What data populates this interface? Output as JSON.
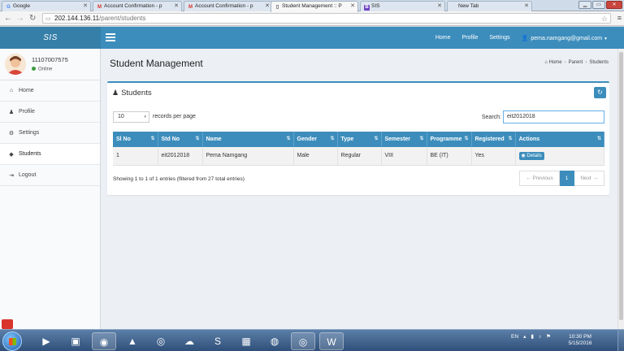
{
  "browser": {
    "tabs": [
      {
        "label": "Google",
        "icon": "G",
        "icon_color": "#4285f4"
      },
      {
        "label": "Account Confirmation - p",
        "icon": "M",
        "icon_color": "#d93025"
      },
      {
        "label": "Account Confirmation - p",
        "icon": "M",
        "icon_color": "#d93025"
      },
      {
        "label": "Student Management :: P",
        "icon": "▯",
        "icon_color": "#555555"
      },
      {
        "label": "SIS",
        "icon": "B",
        "icon_color": "#6f42c1"
      },
      {
        "label": "New Tab",
        "icon": "",
        "icon_color": "#777777"
      }
    ],
    "url_host": "202.144.136.11",
    "url_path": "/parent/students"
  },
  "app": {
    "logo": "SIS",
    "nav": {
      "home": "Home",
      "profile": "Profile",
      "settings": "Settings",
      "user_email": "pema.namgang@gmail.com"
    },
    "user": {
      "id": "11107007575",
      "status": "Online"
    },
    "sidebar": [
      {
        "label": "Home",
        "icon": "home-icon",
        "glyph": "⌂"
      },
      {
        "label": "Profile",
        "icon": "user-icon",
        "glyph": "●"
      },
      {
        "label": "Settings",
        "icon": "gear-icon",
        "glyph": "⚙"
      },
      {
        "label": "Students",
        "icon": "graduation-cap-icon",
        "glyph": "🎓"
      },
      {
        "label": "Logout",
        "icon": "sign-out-icon",
        "glyph": "⇥"
      }
    ],
    "page_title": "Student Management",
    "breadcrumb": [
      "Home",
      "Parent",
      "Students"
    ],
    "box_title": "Students",
    "length_value": "10",
    "length_label": "records per page",
    "search_label": "Search:",
    "search_value": "eit2012018",
    "table": {
      "columns": [
        "Sl No",
        "Std No",
        "Name",
        "Gender",
        "Type",
        "Semester",
        "Programme",
        "Registered",
        "Actions"
      ],
      "rows": [
        [
          "1",
          "eit2012018",
          "Pema Namgang",
          "Male",
          "Regular",
          "VIII",
          "BE (IT)",
          "Yes",
          "Details"
        ]
      ]
    },
    "info": "Showing 1 to 1 of 1 entries (filtered from 27 total entries)",
    "pager": {
      "prev": "← Previous",
      "current": "1",
      "next": "Next →"
    }
  },
  "taskbar": {
    "lang": "EN",
    "time": "10:30 PM",
    "date": "5/15/2016"
  },
  "colors": {
    "primary": "#3c8dbc",
    "logo_bg": "#367fa9",
    "online": "#3c9a3c"
  }
}
